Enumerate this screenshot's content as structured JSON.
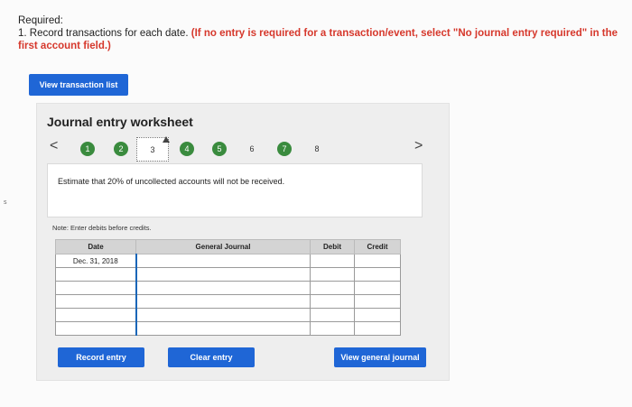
{
  "required": {
    "title": "Required:",
    "line_prefix": "1. Record transactions for each date.",
    "instruction": "(If no entry is required for a transaction/event, select \"No journal entry required\" in the first account field.)"
  },
  "buttons": {
    "view_transaction_list": "View transaction list",
    "record_entry": "Record entry",
    "clear_entry": "Clear entry",
    "view_general_journal": "View general journal"
  },
  "worksheet": {
    "title": "Journal entry worksheet",
    "prev": "<",
    "next": ">",
    "steps": [
      "1",
      "2",
      "3",
      "4",
      "5",
      "6",
      "7",
      "8"
    ],
    "current_step": "3",
    "description": "Estimate that 20% of uncollected accounts will not be received.",
    "note": "Note: Enter debits before credits."
  },
  "journal": {
    "headers": [
      "Date",
      "General Journal",
      "Debit",
      "Credit"
    ],
    "date_value": "Dec. 31, 2018"
  },
  "colors": {
    "primary_button": "#1f66d6",
    "completed_step": "#3a8b3e",
    "instruction_red": "#d6382c"
  }
}
